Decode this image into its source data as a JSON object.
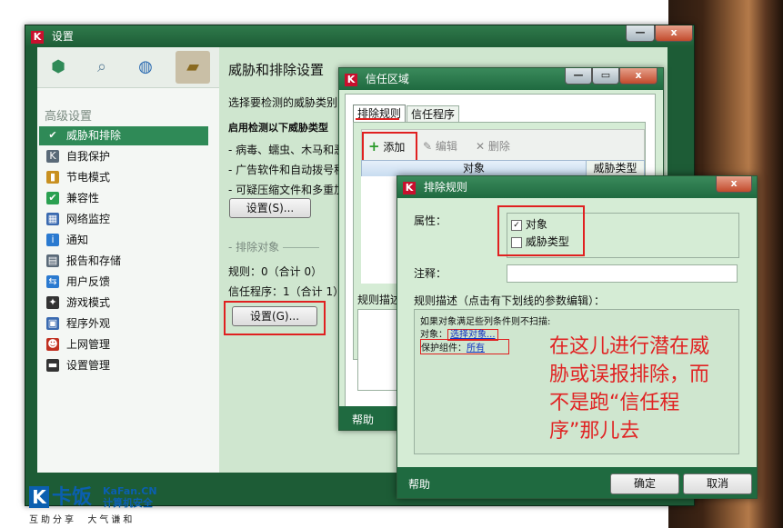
{
  "settings_window": {
    "title": "设置",
    "minimize": "—",
    "close": "x",
    "sidebar_heading": "高级设置",
    "sidebar_items": [
      {
        "label": "威胁和排除",
        "icon": "✔"
      },
      {
        "label": "自我保护",
        "icon": "K"
      },
      {
        "label": "节电模式",
        "icon": "▮"
      },
      {
        "label": "兼容性",
        "icon": "✔"
      },
      {
        "label": "网络监控",
        "icon": "▦"
      },
      {
        "label": "通知",
        "icon": "i"
      },
      {
        "label": "报告和存储",
        "icon": "▤"
      },
      {
        "label": "用户反馈",
        "icon": "⇆"
      },
      {
        "label": "游戏模式",
        "icon": "✦"
      },
      {
        "label": "程序外观",
        "icon": "▣"
      },
      {
        "label": "上网管理",
        "icon": "☻"
      },
      {
        "label": "设置管理",
        "icon": "▬"
      }
    ],
    "panel": {
      "title": "威胁和排除设置",
      "intro": "选择要检测的威胁类别",
      "enable_label": "启用检测以下威胁类型",
      "threat_lines": [
        "- 病毒、蠕虫、木马和恶",
        "- 广告软件和自动拨号程",
        "- 可疑压缩文件和多重加"
      ],
      "settings_btn_1": "设置(S)...",
      "exclusions_heading": "排除对象",
      "rules_line": "规则：0（合计 0）",
      "trusted_line": "信任程序：1（合计 1）",
      "settings_btn_2": "设置(G)..."
    }
  },
  "trust_window": {
    "title": "信任区域",
    "tabs": [
      "排除规则",
      "信任程序"
    ],
    "toolbar": {
      "add": "添加",
      "edit": "编辑",
      "delete": "删除"
    },
    "columns": [
      "对象",
      "威胁类型"
    ],
    "rule_desc_label": "规则描述",
    "help": "帮助"
  },
  "rule_window": {
    "title": "排除规则",
    "close": "x",
    "properties_label": "属性：",
    "checkbox_object": "对象",
    "checkbox_threat": "威胁类型",
    "comment_label": "注释：",
    "comment_value": "",
    "desc_label": "规则描述（点击有下划线的参数编辑）：",
    "desc_line1": "如果对象满足些列条件则不扫描:",
    "desc_object_label": "对象：",
    "desc_object_link": "选择对象...",
    "desc_component_label": "保护组件：",
    "desc_component_link": "所有",
    "help": "帮助",
    "ok": "确定",
    "cancel": "取消"
  },
  "annotation": {
    "lines": [
      "在这儿进行潜在威",
      "胁或误报排除，而",
      "不是跑“信任程",
      "序”那儿去"
    ]
  },
  "brand": {
    "name": "卡饭",
    "site": "KaFan.CN",
    "subtitle": "计算机安全",
    "slogan": "互助分享  大气谦和"
  },
  "colors": {
    "window_green": "#1d5c36",
    "panel_green": "#cfe6cf",
    "highlight_red": "#e02020",
    "sidebar_active": "#2f8a57"
  }
}
